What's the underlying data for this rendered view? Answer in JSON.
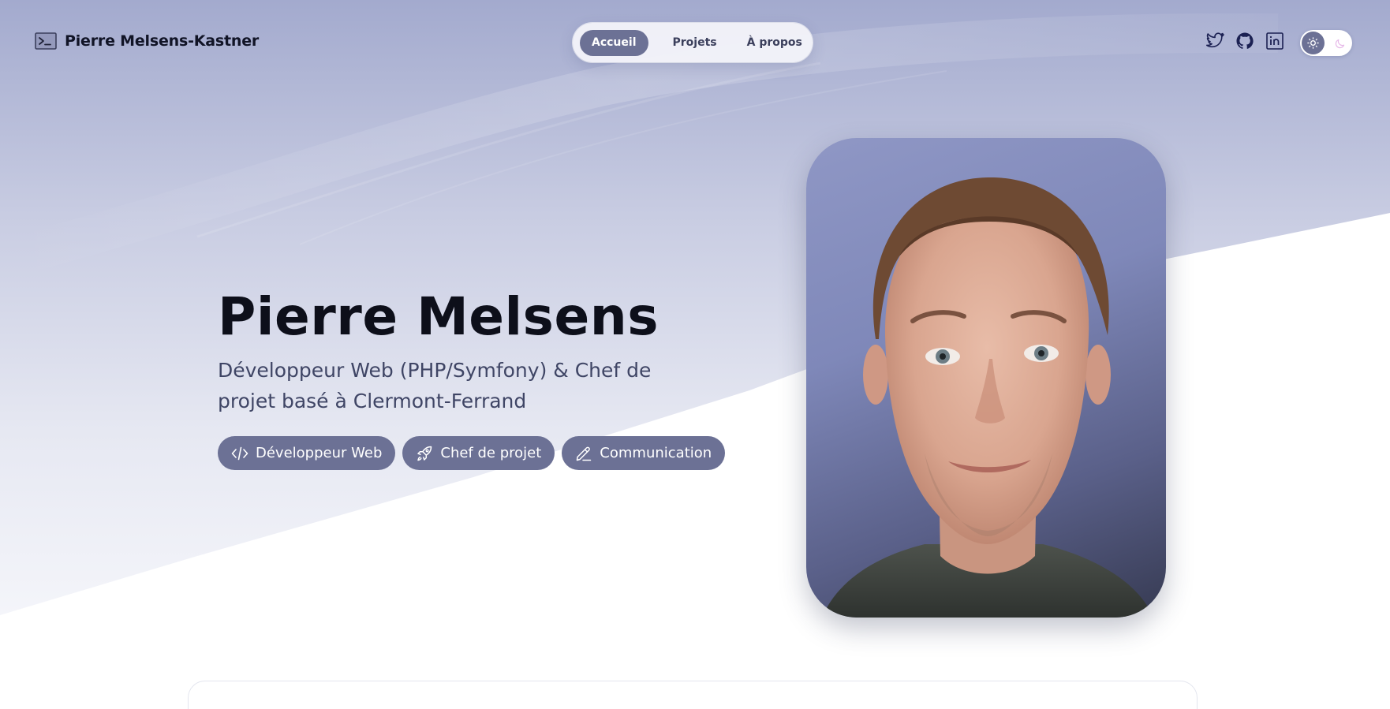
{
  "brand": {
    "name": "Pierre Melsens-Kastner",
    "icon": "terminal-icon"
  },
  "nav": {
    "items": [
      {
        "label": "Accueil",
        "active": true
      },
      {
        "label": "Projets",
        "active": false
      },
      {
        "label": "À propos",
        "active": false
      }
    ]
  },
  "socials": [
    {
      "name": "twitter",
      "icon": "twitter-icon"
    },
    {
      "name": "github",
      "icon": "github-icon"
    },
    {
      "name": "linkedin",
      "icon": "linkedin-icon"
    }
  ],
  "theme_toggle": {
    "mode": "light",
    "icons": [
      "sun-icon",
      "moon-icon"
    ]
  },
  "hero": {
    "title": "Pierre Melsens",
    "subtitle": "Développeur Web (PHP/Symfony) & Chef de projet basé à Clermont-Ferrand",
    "tags": [
      {
        "label": "Développeur Web",
        "icon": "code-icon"
      },
      {
        "label": "Chef de projet",
        "icon": "rocket-icon"
      },
      {
        "label": "Communication",
        "icon": "pencil-icon"
      }
    ]
  },
  "colors": {
    "accent": "#6c7195",
    "title": "#0d0f1a",
    "subtitle": "#3f4565",
    "background_gradient_top": "#a3aace",
    "background": "#ffffff"
  }
}
